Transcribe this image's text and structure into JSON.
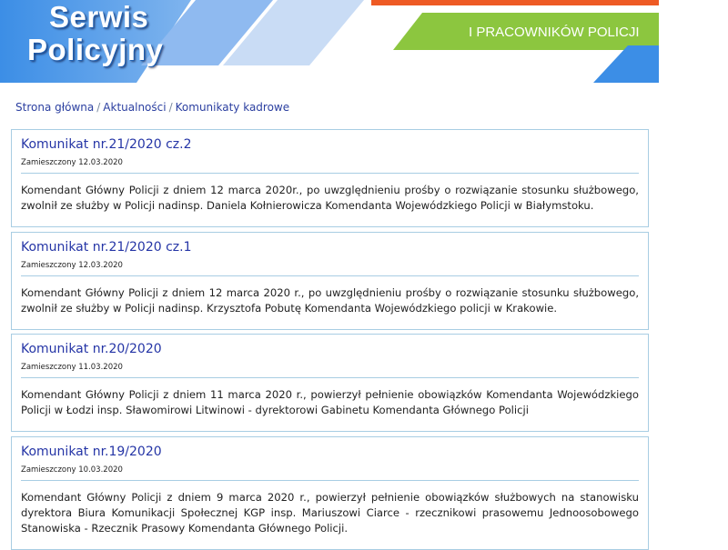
{
  "header": {
    "logo_line1": "Serwis",
    "logo_line2": "Policyjny",
    "band_text": "I PRACOWNIKÓW POLICJI",
    "colors": {
      "blue": "#3c8ee6",
      "green": "#8cc63f",
      "orange": "#ee5a24",
      "light_blue": "#c9dcf5"
    }
  },
  "breadcrumb": {
    "items": [
      "Strona główna",
      "Aktualności",
      "Komunikaty kadrowe"
    ],
    "separator": "/"
  },
  "articles": [
    {
      "title": "Komunikat nr.21/2020 cz.2",
      "meta": "Zamieszczony 12.03.2020",
      "body": "Komendant Główny Policji z dniem 12 marca 2020r., po uwzględnieniu prośby o rozwiązanie stosunku służbowego, zwolnił ze służby w Policji nadinsp. Daniela Kołnierowicza Komendanta Wojewódzkiego Policji w Białymstoku."
    },
    {
      "title": "Komunikat nr.21/2020 cz.1",
      "meta": "Zamieszczony 12.03.2020",
      "body": "Komendant Główny Policji z dniem 12 marca 2020 r., po uwzględnieniu prośby o rozwiązanie stosunku służbowego, zwolnił ze służby w Policji nadinsp. Krzysztofa Pobutę Komendanta Wojewódzkiego policji w Krakowie."
    },
    {
      "title": "Komunikat nr.20/2020",
      "meta": "Zamieszczony 11.03.2020",
      "body": "Komendant Główny Policji z dniem 11 marca 2020 r., powierzył pełnienie obowiązków Komendanta Wojewódzkiego Policji w Łodzi insp. Sławomirowi Litwinowi - dyrektorowi Gabinetu Komendanta Głównego Policji"
    },
    {
      "title": "Komunikat nr.19/2020",
      "meta": "Zamieszczony 10.03.2020",
      "body": "Komendant Główny Policji z dniem 9 marca 2020 r., powierzył pełnienie obowiązków służbowych na stanowisku dyrektora Biura Komunikacji Społecznej KGP insp. Mariuszowi Ciarce - rzecznikowi prasowemu Jednoosobowego Stanowiska - Rzecznik Prasowy Komendanta Głównego Policji."
    }
  ]
}
